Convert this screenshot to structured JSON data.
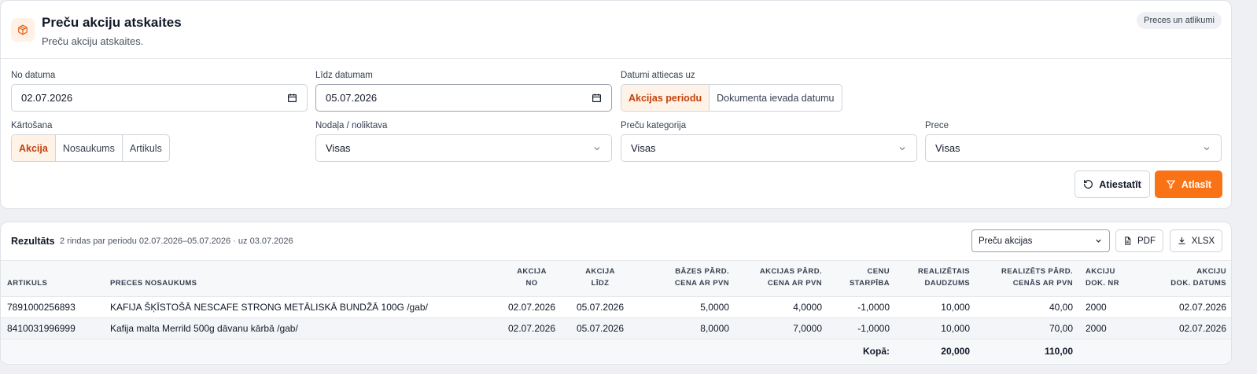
{
  "header": {
    "title": "Preču akciju atskaites",
    "subtitle": "Preču akciju atskaites.",
    "badge": "Preces un atlikumi",
    "icon": "box-icon"
  },
  "filters": {
    "date_from": {
      "label": "No datuma",
      "value": "02.07.2026"
    },
    "date_to": {
      "label": "Līdz datumam",
      "value": "05.07.2026"
    },
    "date_applies": {
      "label": "Datumi attiecas uz",
      "options": [
        "Akcijas periodu",
        "Dokumenta ievada datumu"
      ],
      "selected": "Akcijas periodu"
    },
    "sorting": {
      "label": "Kārtošana",
      "options": [
        "Akcija",
        "Nosaukums",
        "Artikuls"
      ],
      "selected": "Akcija"
    },
    "department": {
      "label": "Nodaļa / noliktava",
      "value": "Visas"
    },
    "category": {
      "label": "Preču kategorija",
      "value": "Visas"
    },
    "product": {
      "label": "Prece",
      "value": "Visas"
    },
    "reset_label": "Atiestatīt",
    "search_label": "Atlasīt"
  },
  "results": {
    "title": "Rezultāts",
    "info": "2 rindas par periodu 02.07.2026–05.07.2026 · uz 03.07.2026",
    "view_select": "Preču akcijas",
    "pdf_label": "PDF",
    "xlsx_label": "XLSX",
    "columns": [
      {
        "l1": "",
        "l2": "Artikuls"
      },
      {
        "l1": "",
        "l2": "Preces nosaukums"
      },
      {
        "l1": "Akcija",
        "l2": "no"
      },
      {
        "l1": "Akcija",
        "l2": "līdz"
      },
      {
        "l1": "Bāzes pārd.",
        "l2": "cena ar PVN"
      },
      {
        "l1": "Akcijas pārd.",
        "l2": "cena ar PVN"
      },
      {
        "l1": "Cenu",
        "l2": "starpība"
      },
      {
        "l1": "Realizētais",
        "l2": "daudzums"
      },
      {
        "l1": "Realizēts pārd.",
        "l2": "cenās ar PVN"
      },
      {
        "l1": "Akciju",
        "l2": "dok. nr"
      },
      {
        "l1": "Akciju",
        "l2": "dok. datums"
      }
    ],
    "rows": [
      [
        "7891000256893",
        "KAFIJA ŠĶĪSTOŠĀ NESCAFE STRONG METĀLISKĀ BUNDŽĀ 100G /gab/",
        "02.07.2026",
        "05.07.2026",
        "5,0000",
        "4,0000",
        "-1,0000",
        "10,000",
        "40,00",
        "2000",
        "02.07.2026"
      ],
      [
        "8410031996999",
        "Kafija malta Merrild 500g dāvanu kārbā /gab/",
        "02.07.2026",
        "05.07.2026",
        "8,0000",
        "7,0000",
        "-1,0000",
        "10,000",
        "70,00",
        "2000",
        "02.07.2026"
      ]
    ],
    "totals": {
      "label": "Kopā:",
      "quantity": "20,000",
      "amount": "110,00"
    }
  },
  "colors": {
    "accent": "#f97316",
    "accent_soft": "#fff3e8"
  }
}
